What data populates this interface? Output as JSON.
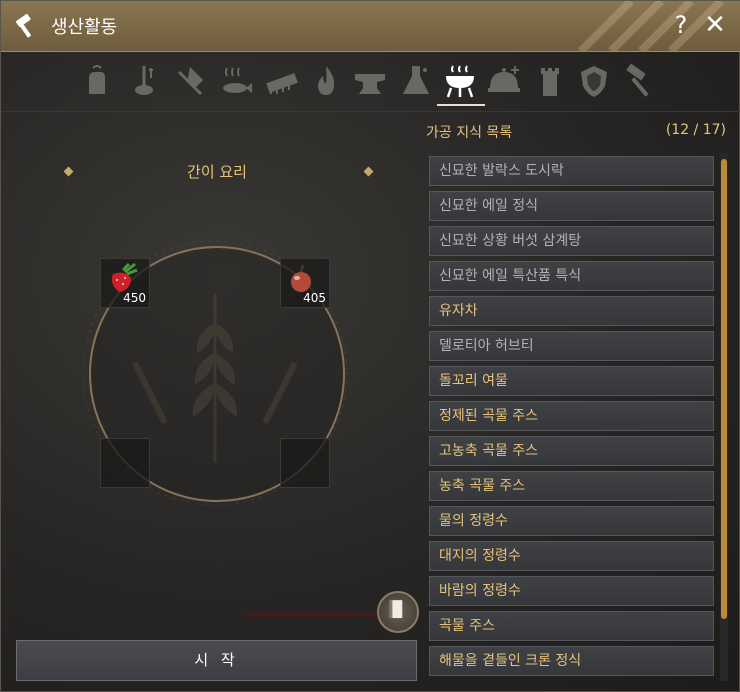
{
  "window": {
    "title": "생산활동",
    "help_label": "?",
    "close_label": "✕"
  },
  "tabs": [
    {
      "name": "gathering-tab",
      "icon": "glove-icon"
    },
    {
      "name": "fishing-tab",
      "icon": "fishing-rod-icon"
    },
    {
      "name": "hunting-tab",
      "icon": "axe-icon"
    },
    {
      "name": "cooking-tab",
      "icon": "steam-fish-icon"
    },
    {
      "name": "training-tab",
      "icon": "brush-icon"
    },
    {
      "name": "alchemy-fire-tab",
      "icon": "fire-icon"
    },
    {
      "name": "processing-tab",
      "icon": "anvil-icon"
    },
    {
      "name": "alchemy-tab",
      "icon": "flask-icon"
    },
    {
      "name": "simple-cooking-tab",
      "icon": "grill-icon",
      "active": true
    },
    {
      "name": "cooking-dish-tab",
      "icon": "cloche-icon"
    },
    {
      "name": "alchemy-tower-tab",
      "icon": "tower-icon"
    },
    {
      "name": "guild-tab",
      "icon": "shield-crest-icon"
    },
    {
      "name": "repair-tab",
      "icon": "hammer-icon"
    }
  ],
  "left_panel": {
    "recipe_title": "간이 요리",
    "slots": [
      {
        "icon": "strawberry-icon",
        "count": "450"
      },
      {
        "icon": "apple-icon",
        "count": "405"
      },
      {
        "icon": "",
        "count": ""
      },
      {
        "icon": "",
        "count": ""
      }
    ],
    "start_label": "시 작"
  },
  "right_panel": {
    "header": "가공 지식 목록",
    "count": "(12 / 17)",
    "items": [
      {
        "label": "신묘한 발락스 도시락",
        "learned": false
      },
      {
        "label": "신묘한 에일 정식",
        "learned": false
      },
      {
        "label": "신묘한 상황 버섯 삼계탕",
        "learned": false
      },
      {
        "label": "신묘한 에일 특산품 특식",
        "learned": false
      },
      {
        "label": "유자차",
        "learned": true
      },
      {
        "label": "델로티아 허브티",
        "learned": false
      },
      {
        "label": "돌꼬리 여물",
        "learned": true
      },
      {
        "label": "정제된 곡물 주스",
        "learned": true
      },
      {
        "label": "고농축 곡물 주스",
        "learned": true
      },
      {
        "label": "농축 곡물 주스",
        "learned": true
      },
      {
        "label": "물의 정령수",
        "learned": true
      },
      {
        "label": "대지의 정령수",
        "learned": true
      },
      {
        "label": "바람의 정령수",
        "learned": true
      },
      {
        "label": "곡물 주스",
        "learned": true
      },
      {
        "label": "해물을 곁들인 크론 정식",
        "learned": true
      }
    ]
  },
  "colors": {
    "title_bar": "#7a6848",
    "learned_text": "#e7c37b",
    "unlearned_text": "#b2b2b2",
    "scroll_thumb": "#b88a3a"
  }
}
